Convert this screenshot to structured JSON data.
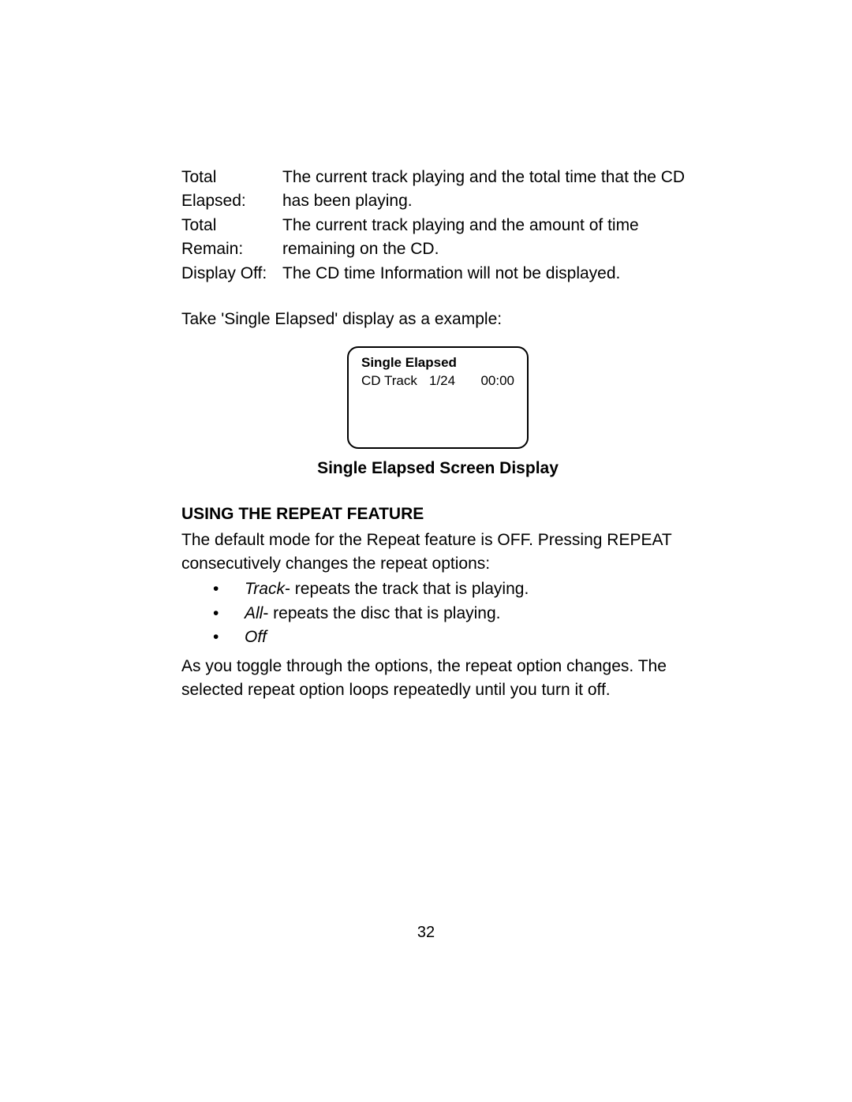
{
  "definitions": [
    {
      "label": "Total Elapsed:",
      "text": "The current  track playing and the total time that the CD has been playing."
    },
    {
      "label": "Total Remain:",
      "text": "The current track playing and  the amount of time remaining on the CD."
    },
    {
      "label": "Display Off:",
      "text": "The CD time Information will not be displayed."
    }
  ],
  "example_intro": "Take 'Single Elapsed' display as a example:",
  "screen": {
    "title": "Single Elapsed",
    "cd_label": "CD Track",
    "track": "1/24",
    "time": "00:00"
  },
  "caption": "Single Elapsed Screen Display",
  "section_head": "USING THE REPEAT FEATURE",
  "repeat_intro": "The default mode for the Repeat feature is OFF. Pressing  REPEAT consecutively  changes the repeat options:",
  "repeat_options": [
    {
      "em": "Track",
      "rest": "- repeats the track that is playing."
    },
    {
      "em": "All",
      "rest": "- repeats the disc that is playing."
    },
    {
      "em": "Off",
      "rest": ""
    }
  ],
  "repeat_outro": "As you toggle through the options, the repeat option changes.  The selected repeat option loops repeatedly until you turn it off.",
  "page_number": "32"
}
